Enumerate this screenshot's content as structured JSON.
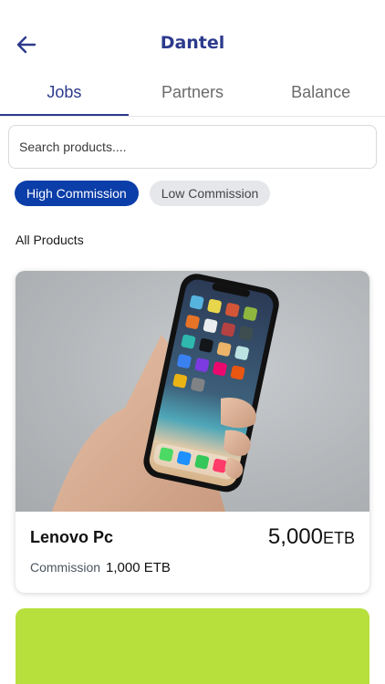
{
  "header": {
    "title": "Dantel",
    "back_icon": "arrow-left-icon"
  },
  "tabs": [
    {
      "label": "Jobs",
      "active": true
    },
    {
      "label": "Partners",
      "active": false
    },
    {
      "label": "Balance",
      "active": false
    }
  ],
  "search": {
    "placeholder": "Search products...."
  },
  "filters": [
    {
      "label": "High Commission",
      "active": true
    },
    {
      "label": "Low Commission",
      "active": false
    }
  ],
  "section": {
    "label": "All Products"
  },
  "products": [
    {
      "name": "Lenovo Pc",
      "price": "5,000",
      "currency": "ETB",
      "commission_label": "Commission",
      "commission_value": "1,000 ETB",
      "image": "phone-in-hand-photo"
    },
    {
      "image_color": "#b7e03c"
    }
  ],
  "colors": {
    "brand": "#2c3a8c",
    "chip_active": "#0b3ea8",
    "chip_inactive": "#e5e7eb"
  }
}
